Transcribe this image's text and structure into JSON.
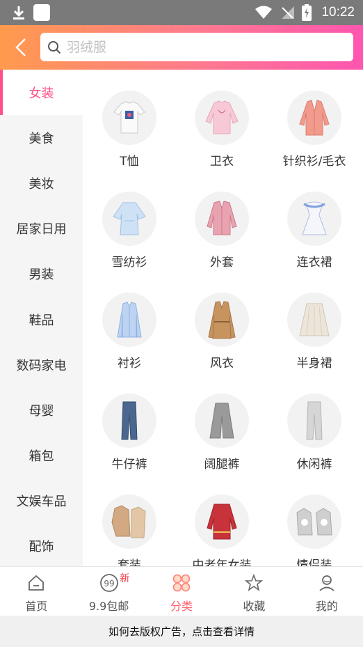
{
  "status_bar": {
    "time": "10:22"
  },
  "search": {
    "placeholder": "羽绒服"
  },
  "sidebar": {
    "items": [
      {
        "label": "女装",
        "active": true
      },
      {
        "label": "美食"
      },
      {
        "label": "美妆"
      },
      {
        "label": "居家日用"
      },
      {
        "label": "男装"
      },
      {
        "label": "鞋品"
      },
      {
        "label": "数码家电"
      },
      {
        "label": "母婴"
      },
      {
        "label": "箱包"
      },
      {
        "label": "文娱车品"
      },
      {
        "label": "配饰"
      }
    ]
  },
  "categories": [
    {
      "label": "T恤"
    },
    {
      "label": "卫衣"
    },
    {
      "label": "针织衫/毛衣"
    },
    {
      "label": "雪纺衫"
    },
    {
      "label": "外套"
    },
    {
      "label": "连衣裙"
    },
    {
      "label": "衬衫"
    },
    {
      "label": "风衣"
    },
    {
      "label": "半身裙"
    },
    {
      "label": "牛仔裤"
    },
    {
      "label": "阔腿裤"
    },
    {
      "label": "休闲裤"
    },
    {
      "label": "套装"
    },
    {
      "label": "中老年女装"
    },
    {
      "label": "情侣装"
    }
  ],
  "tabbar": {
    "tabs": [
      {
        "label": "首页",
        "icon": "home-icon"
      },
      {
        "label": "9.9包邮",
        "icon": "nine-nine-icon",
        "badge": "新"
      },
      {
        "label": "分类",
        "icon": "category-icon",
        "active": true
      },
      {
        "label": "收藏",
        "icon": "star-icon"
      },
      {
        "label": "我的",
        "icon": "profile-icon"
      }
    ]
  },
  "ad_bar": {
    "text": "如何去版权广告，点击查看详情"
  },
  "colors": {
    "accent": "#ff4f87",
    "header_start": "#ff9a4d",
    "header_end": "#ff55b0",
    "tab_active": "#ff5f6e"
  }
}
